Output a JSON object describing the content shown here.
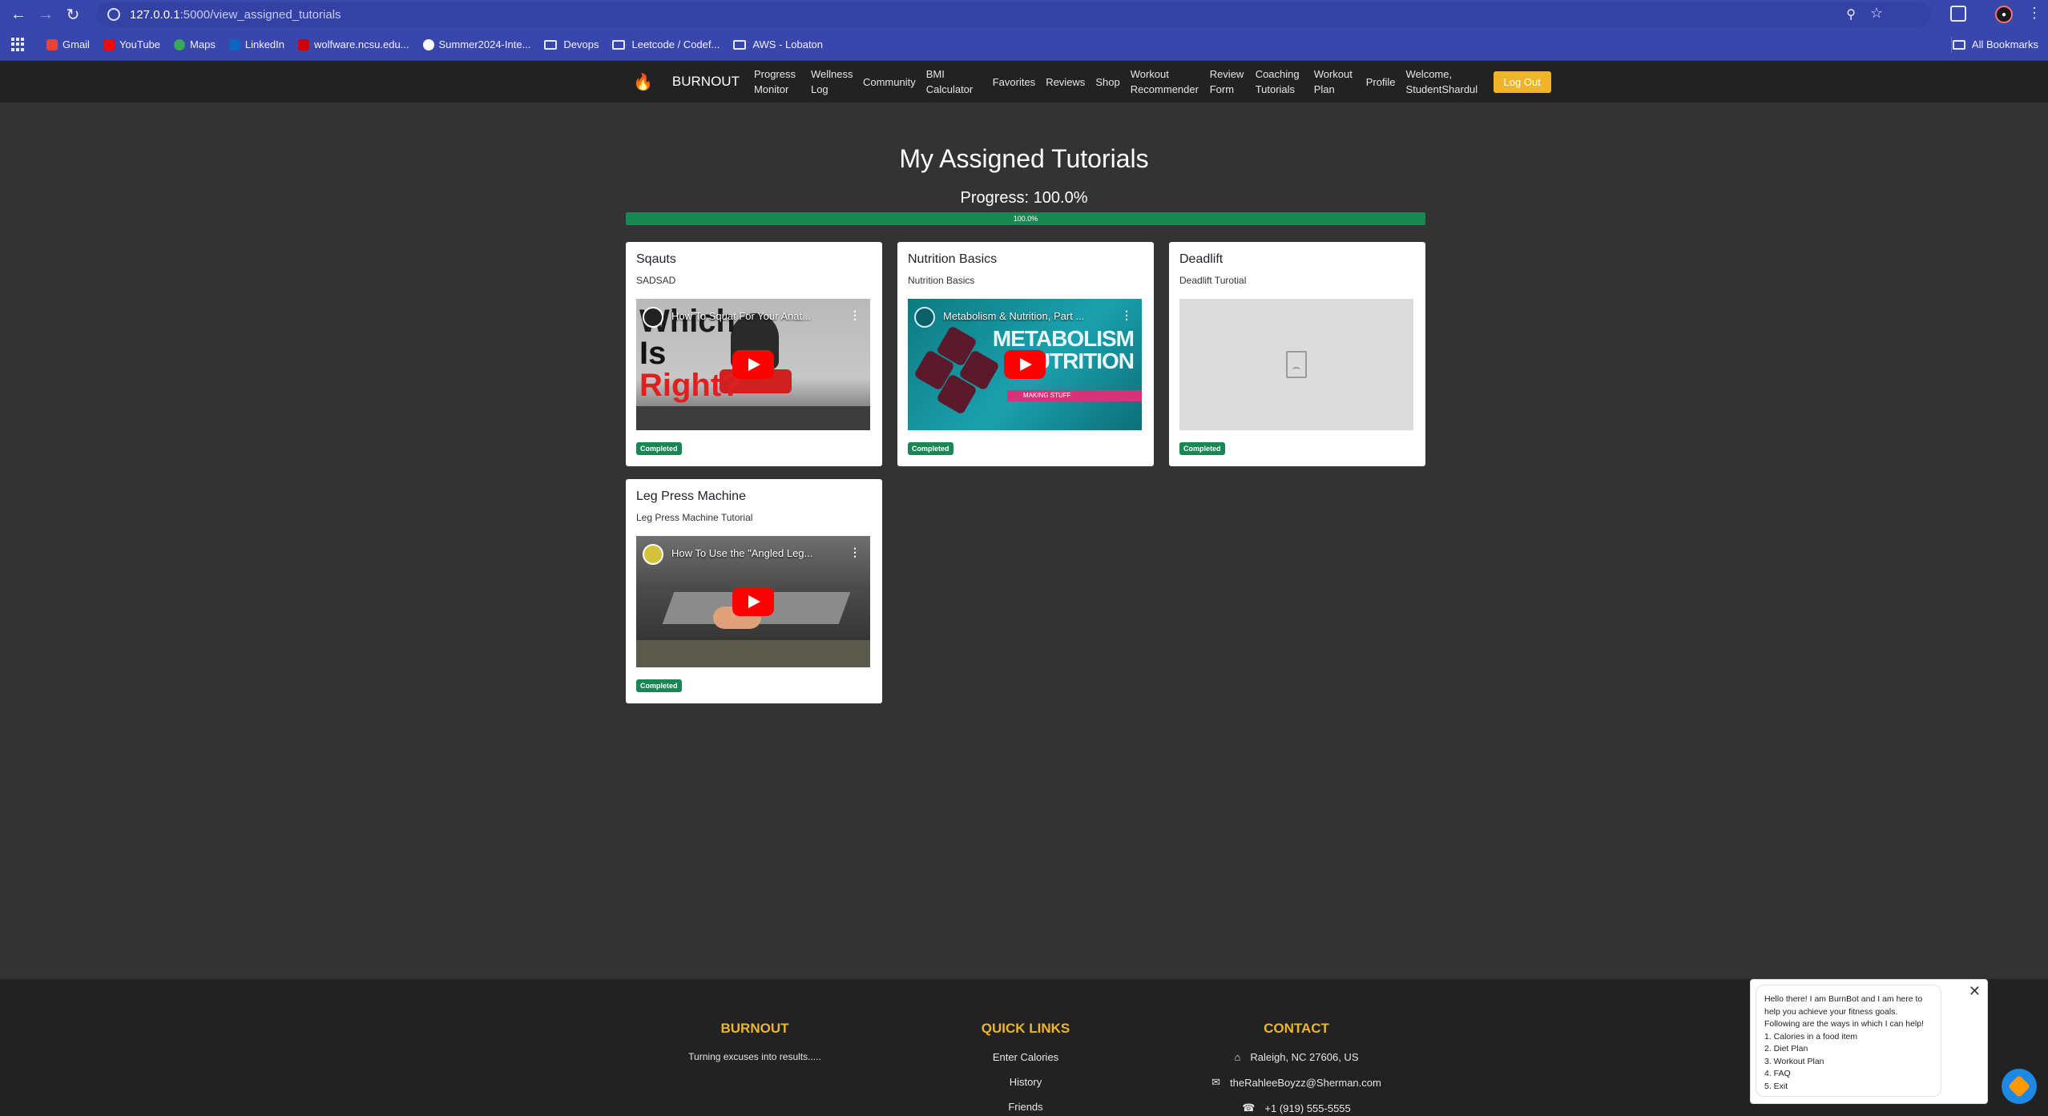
{
  "browser": {
    "url_host": "127.0.0.1",
    "url_path": ":5000/view_assigned_tutorials",
    "bookmarks": [
      {
        "label": "Gmail",
        "color": "#ea4335"
      },
      {
        "label": "YouTube",
        "color": "#ff0000"
      },
      {
        "label": "Maps",
        "color": "#34a853"
      },
      {
        "label": "LinkedIn",
        "color": "#0a66c2"
      },
      {
        "label": "wolfware.ncsu.edu...",
        "color": "#cc0000"
      },
      {
        "label": "Summer2024-Inte...",
        "color": "#ffffff"
      },
      {
        "label": "Devops",
        "folder": true
      },
      {
        "label": "Leetcode / Codef...",
        "folder": true
      },
      {
        "label": "AWS - Lobaton",
        "folder": true
      }
    ],
    "all_bookmarks": "All Bookmarks"
  },
  "navbar": {
    "brand": "BURNOUT",
    "links": [
      "Progress Monitor",
      "Wellness Log",
      "Community",
      "BMI Calculator",
      "Favorites",
      "Reviews",
      "Shop",
      "Workout Recommender",
      "Review Form",
      "Coaching Tutorials",
      "Workout Plan",
      "Profile",
      "Welcome, StudentShardul"
    ],
    "logout": "Log Out"
  },
  "main": {
    "title": "My Assigned Tutorials",
    "progress_label": "Progress: 100.0%",
    "progress_value": 100.0,
    "progress_text": "100.0%",
    "tutorials": [
      {
        "title": "Sqauts",
        "description": "SADSAD",
        "video_title": "How To Squat For Your Anat...",
        "thumb_text": [
          "Which",
          "Is",
          "Right?"
        ],
        "status": "Completed"
      },
      {
        "title": "Nutrition Basics",
        "description": "Nutrition Basics",
        "video_title": "Metabolism & Nutrition, Part ...",
        "thumb_text": [
          "METABOLISM",
          "NUTRITION",
          "MAKING STUFF"
        ],
        "status": "Completed"
      },
      {
        "title": "Deadlift",
        "description": "Deadlift Turotial",
        "status": "Completed"
      },
      {
        "title": "Leg Press Machine",
        "description": "Leg Press Machine Tutorial",
        "video_title": "How To Use the \"Angled Leg...",
        "status": "Completed"
      }
    ]
  },
  "footer": {
    "brand_heading": "BURNOUT",
    "tagline": "Turning excuses into results.....",
    "links_heading": "QUICK LINKS",
    "links": [
      "Enter Calories",
      "History",
      "Friends"
    ],
    "contact_heading": "CONTACT",
    "address": "Raleigh, NC 27606, US",
    "email": "theRahleeBoyzz@Sherman.com",
    "phone": "+1 (919) 555-5555"
  },
  "chatbot": {
    "lines": [
      "Hello there! I am BurnBot and I am here to",
      "help you achieve your fitness goals.",
      "Following are the ways in which I can help!",
      "1. Calories in a food item",
      "2. Diet Plan",
      "3. Workout Plan",
      "4. FAQ",
      "5. Exit"
    ]
  },
  "colors": {
    "chrome": "#3947ad",
    "navbar": "#222222",
    "page_bg": "#333333",
    "accent": "#f0b429",
    "success": "#198754"
  }
}
